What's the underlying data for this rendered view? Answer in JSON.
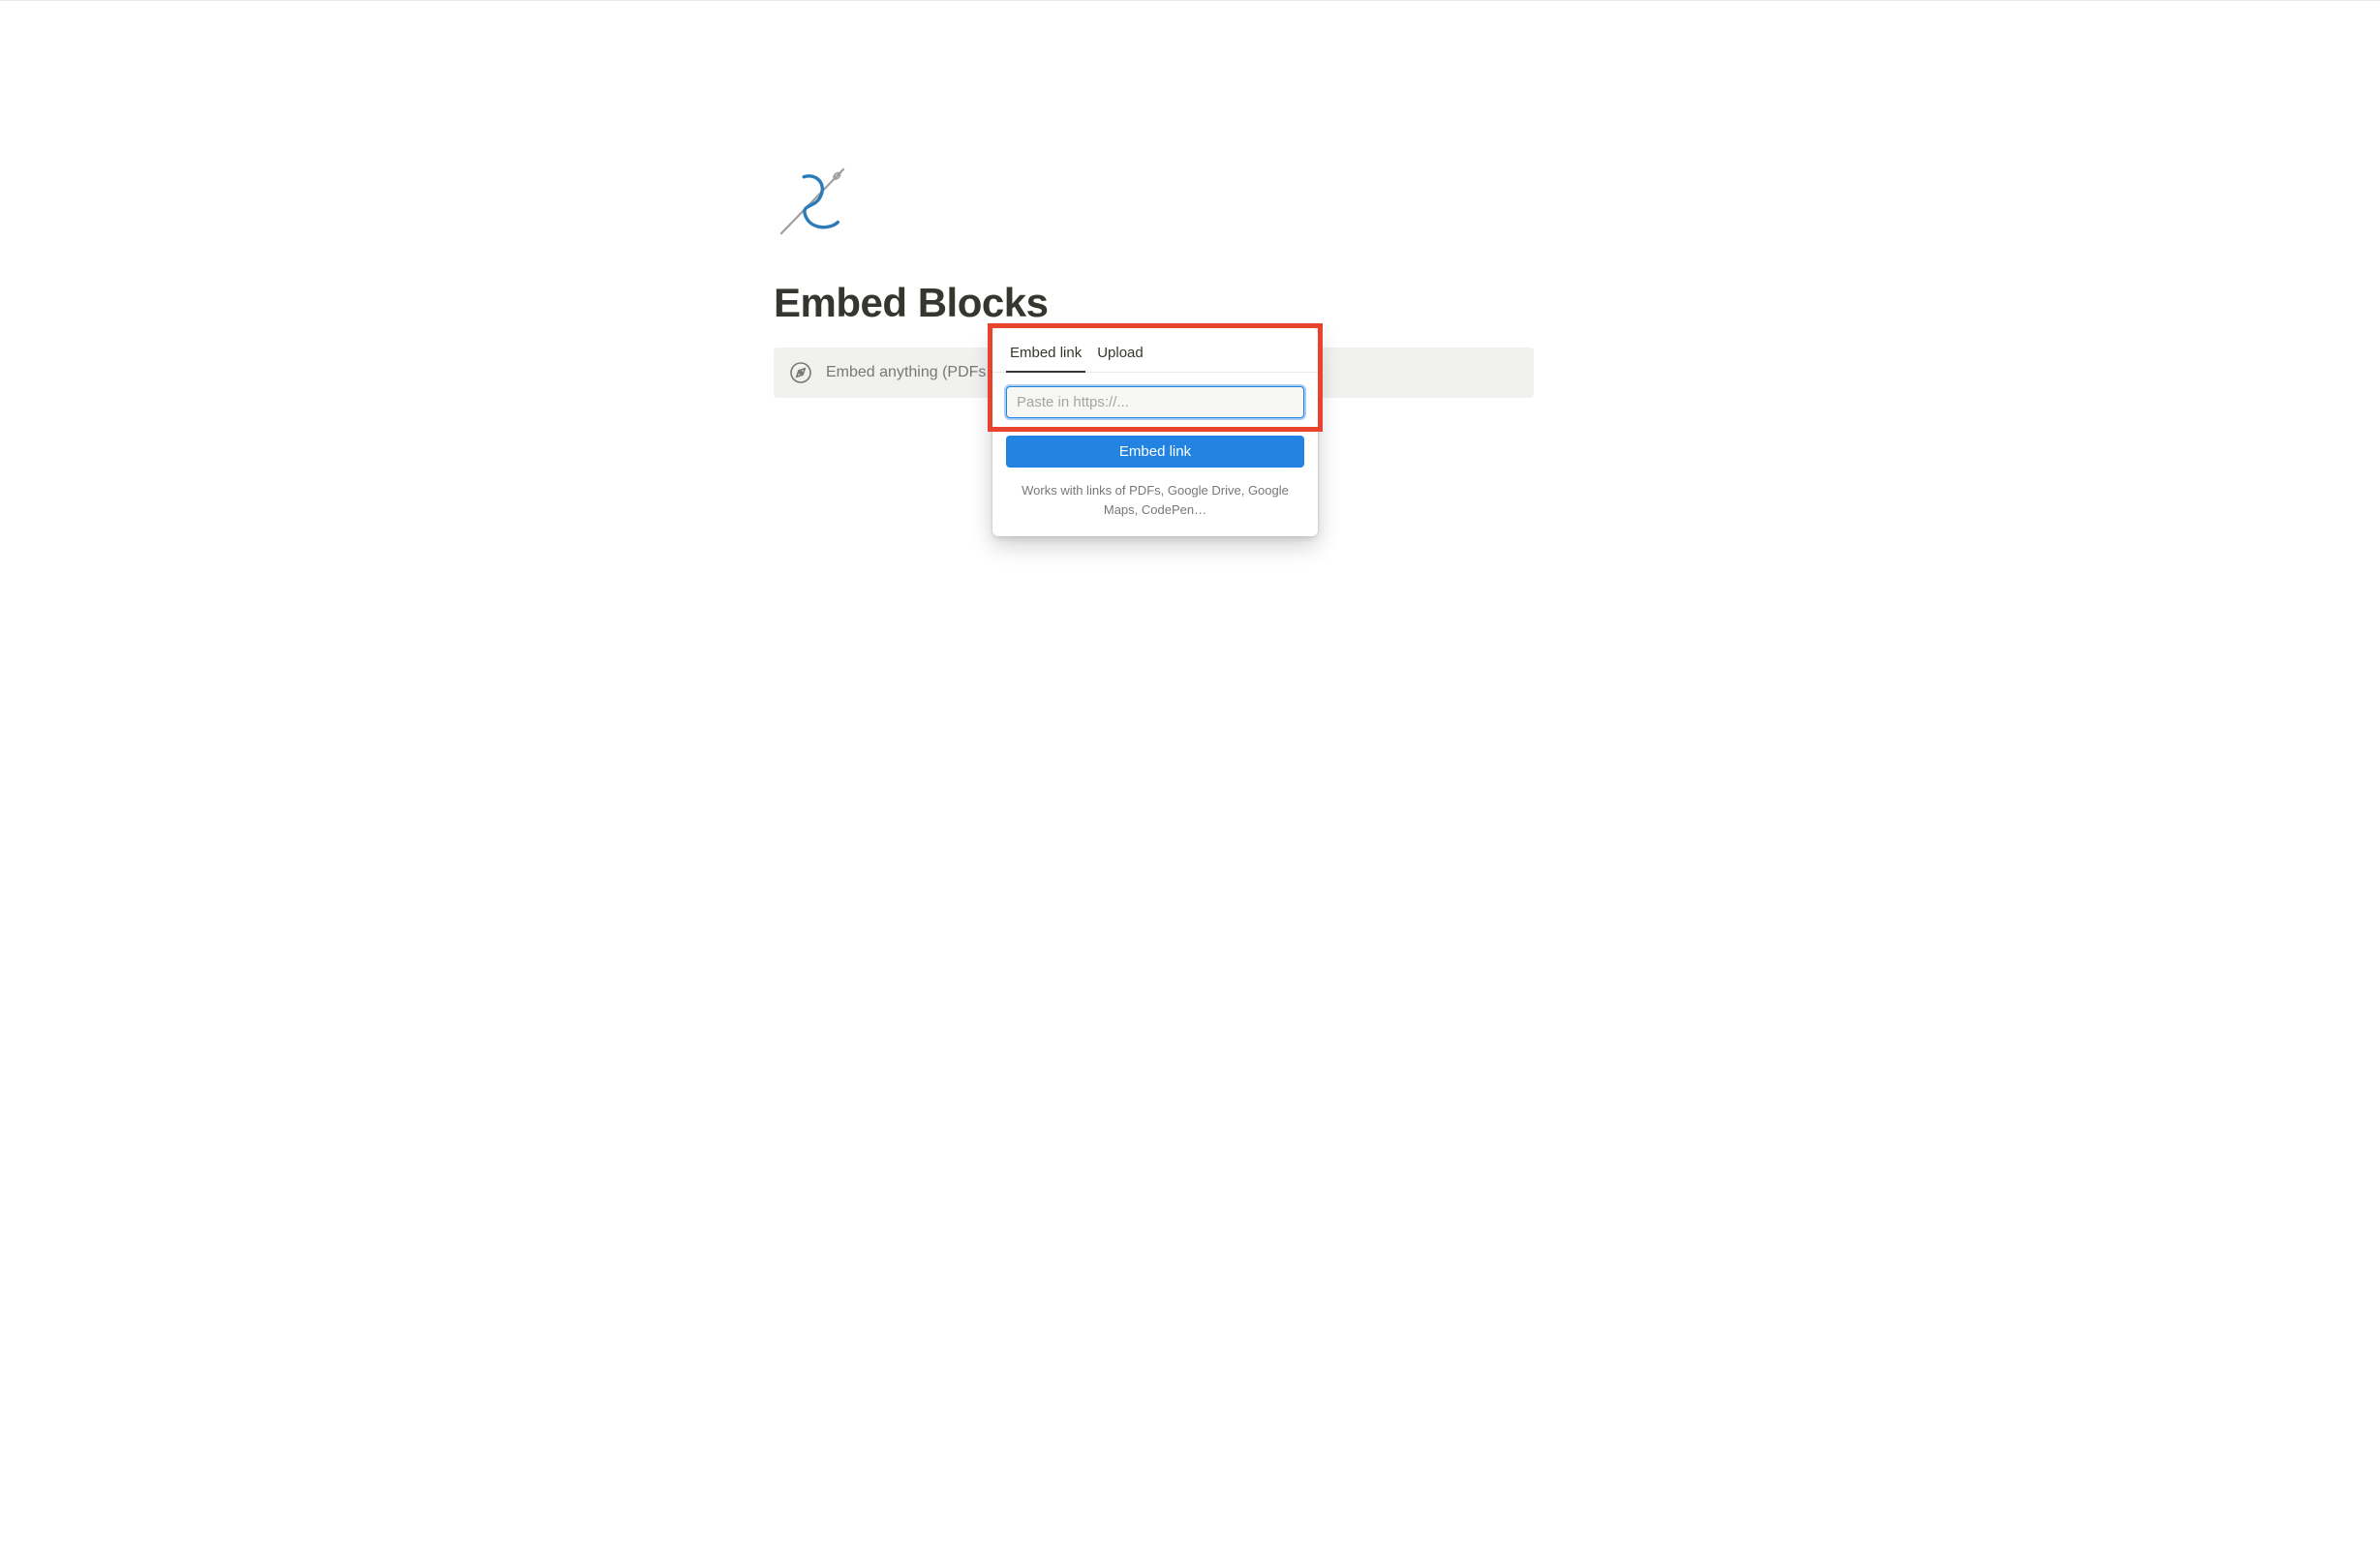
{
  "page": {
    "title": "Embed Blocks",
    "icon_name": "needle-thread-icon"
  },
  "embedBlock": {
    "placeholder_text": "Embed anything (PDFs, Google Docs, Google Maps, Spotify...)"
  },
  "popup": {
    "tabs": {
      "embed_link": "Embed link",
      "upload": "Upload"
    },
    "active_tab": "embed_link",
    "input": {
      "placeholder": "Paste in https://...",
      "value": ""
    },
    "submit_label": "Embed link",
    "helper_text": "Works with links of PDFs, Google Drive, Google Maps, CodePen…"
  },
  "colors": {
    "accent": "#2383e2",
    "highlight": "#e8432e",
    "text": "#37352f",
    "muted": "#787774"
  }
}
